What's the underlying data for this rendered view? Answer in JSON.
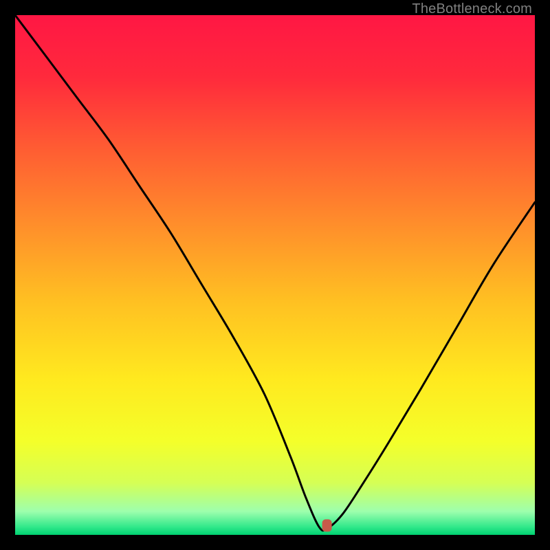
{
  "attribution": "TheBottleneck.com",
  "colors": {
    "frame": "#000000",
    "curve": "#000000",
    "marker": "#c85a4a",
    "gradient_stops": [
      {
        "offset": 0.0,
        "color": "#ff1744"
      },
      {
        "offset": 0.12,
        "color": "#ff2a3c"
      },
      {
        "offset": 0.25,
        "color": "#ff5a33"
      },
      {
        "offset": 0.4,
        "color": "#ff8d2b"
      },
      {
        "offset": 0.55,
        "color": "#ffc022"
      },
      {
        "offset": 0.7,
        "color": "#ffe91f"
      },
      {
        "offset": 0.82,
        "color": "#f4ff2a"
      },
      {
        "offset": 0.9,
        "color": "#d5ff55"
      },
      {
        "offset": 0.955,
        "color": "#9dffad"
      },
      {
        "offset": 0.985,
        "color": "#30e88a"
      },
      {
        "offset": 1.0,
        "color": "#00d171"
      }
    ]
  },
  "chart_data": {
    "type": "line",
    "title": "",
    "xlabel": "",
    "ylabel": "",
    "xlim": [
      0,
      100
    ],
    "ylim": [
      0,
      100
    ],
    "series": [
      {
        "name": "bottleneck-curve",
        "x": [
          0,
          6,
          12,
          18,
          24,
          30,
          36,
          42,
          48,
          53,
          56,
          58.5,
          60,
          63,
          67,
          72,
          78,
          85,
          92,
          100
        ],
        "values": [
          100,
          92,
          84,
          76,
          67,
          58,
          48,
          38,
          27,
          15,
          7,
          1.5,
          1.2,
          4,
          10,
          18,
          28,
          40,
          52,
          64
        ]
      }
    ],
    "marker": {
      "x": 60,
      "y": 1.8
    },
    "flat_min_segment": {
      "x_start": 56,
      "x_end": 61,
      "y": 1.4
    }
  }
}
